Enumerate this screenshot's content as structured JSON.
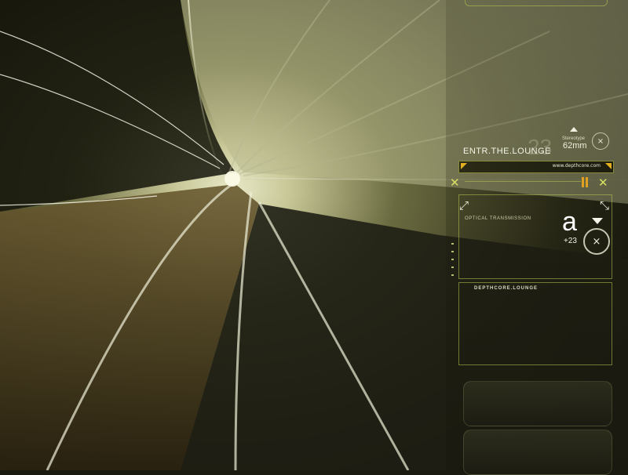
{
  "hud": {
    "title": "ENTR.THE.LOUNGE",
    "url": "www.depthcore.com",
    "stereo_label": "Stereotype",
    "stereo_value": "62mm",
    "ghost_number": "23",
    "optical_label": "OPTICAL TRANSMISSION",
    "big_letter": "a",
    "offset": "+23",
    "lounge_label": "DEPTHCORE.LOUNGE"
  },
  "icons": {
    "close": "×",
    "expand": "⤡",
    "collapse": "⤢",
    "cross_arrows": "✕"
  },
  "colors": {
    "accent": "#d8e060",
    "amber": "#e0a020",
    "text": "#e8ecd0"
  }
}
